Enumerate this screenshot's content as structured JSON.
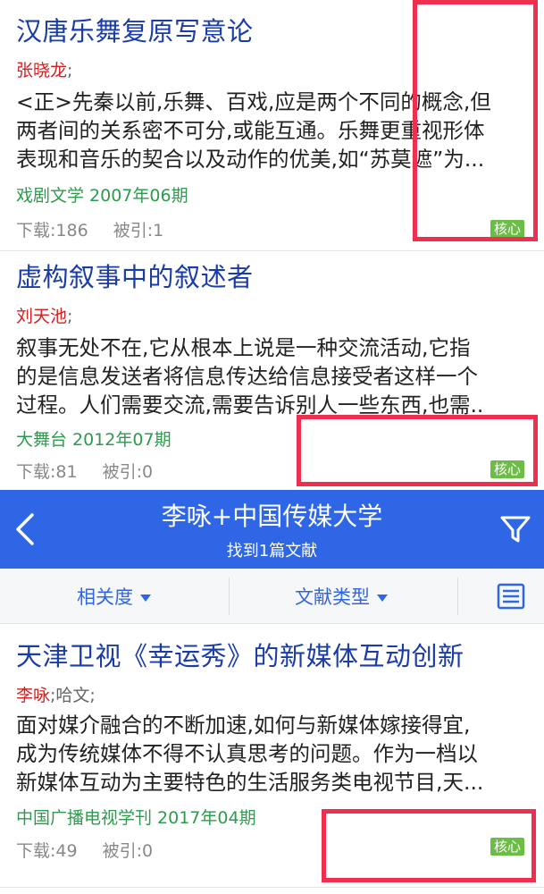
{
  "articles": [
    {
      "title": "汉唐乐舞复原写意论",
      "primary_author": "张晓龙",
      "sep": ";",
      "other_authors": "",
      "abstract_lines": [
        "<正>先秦以前,乐舞、百戏,应是两个不同的概念,但",
        "两者间的关系密不可分,或能互通。乐舞更重视形体",
        "表现和音乐的契合以及动作的优美,如“苏莫遮”为..."
      ],
      "journal": "戏剧文学 2007年06期",
      "downloads": "下载:186",
      "citations": "被引:1",
      "badge": "核心"
    },
    {
      "title": "虚构叙事中的叙述者",
      "primary_author": "刘天池",
      "sep": ";",
      "other_authors": "",
      "abstract_lines": [
        "叙事无处不在,它从根本上说是一种交流活动,它指",
        "的是信息发送者将信息传达给信息接受者这样一个",
        "过程。人们需要交流,需要告诉别人一些东西,也需.."
      ],
      "journal": "大舞台 2012年07期",
      "downloads": "下载:81",
      "citations": "被引:0",
      "badge": "核心"
    },
    {
      "title": "天津卫视《幸运秀》的新媒体互动创新",
      "primary_author": "李咏",
      "sep": ";",
      "other_authors": "哈文;",
      "abstract_lines": [
        "面对媒介融合的不断加速,如何与新媒体嫁接得宜,",
        "成为传统媒体不得不认真思考的问题。作为一档以",
        "新媒体互动为主要特色的生活服务类电视节目,天..."
      ],
      "journal": "中国广播电视学刊 2017年04期",
      "downloads": "下载:49",
      "citations": "被引:0",
      "badge": "核心"
    }
  ],
  "search_header": {
    "title": "李咏+中国传媒大学",
    "subtitle": "找到1篇文献",
    "back_icon": "chevron-left-icon",
    "filter_icon": "funnel-icon"
  },
  "toolbar": {
    "sort_label": "相关度",
    "type_label": "文献类型",
    "list_icon": "list-view-icon"
  },
  "colors": {
    "header_bg": "#2f66e6",
    "title": "#1a3ca8",
    "author": "#d42020",
    "journal": "#2e9a4e",
    "badge_bg": "#6cbd45",
    "highlight": "#ee2f4f"
  }
}
